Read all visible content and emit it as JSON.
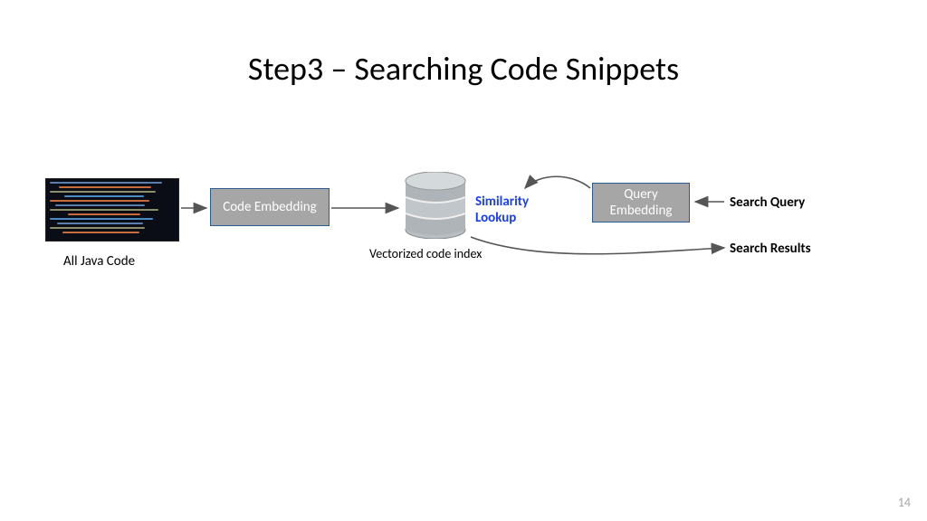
{
  "title": "Step3 – Searching Code Snippets",
  "page_number": "14",
  "nodes": {
    "java_code_caption": "All Java Code",
    "code_embedding_label": "Code Embedding",
    "db_caption": "Vectorized code index",
    "similarity_label": "Similarity\nLookup",
    "query_embedding_label": "Query\nEmbedding",
    "search_query_label": "Search Query",
    "search_results_label": "Search Results"
  },
  "icons": {
    "code_thumb": "java-code-thumbnail",
    "database": "database-cylinder-icon"
  },
  "colors": {
    "box_bg": "#a6a6a6",
    "box_border": "#2a5b8f",
    "similarity_text": "#1a3cff",
    "db_fill": "#bfc5c9",
    "db_dark": "#9fa5a9"
  }
}
